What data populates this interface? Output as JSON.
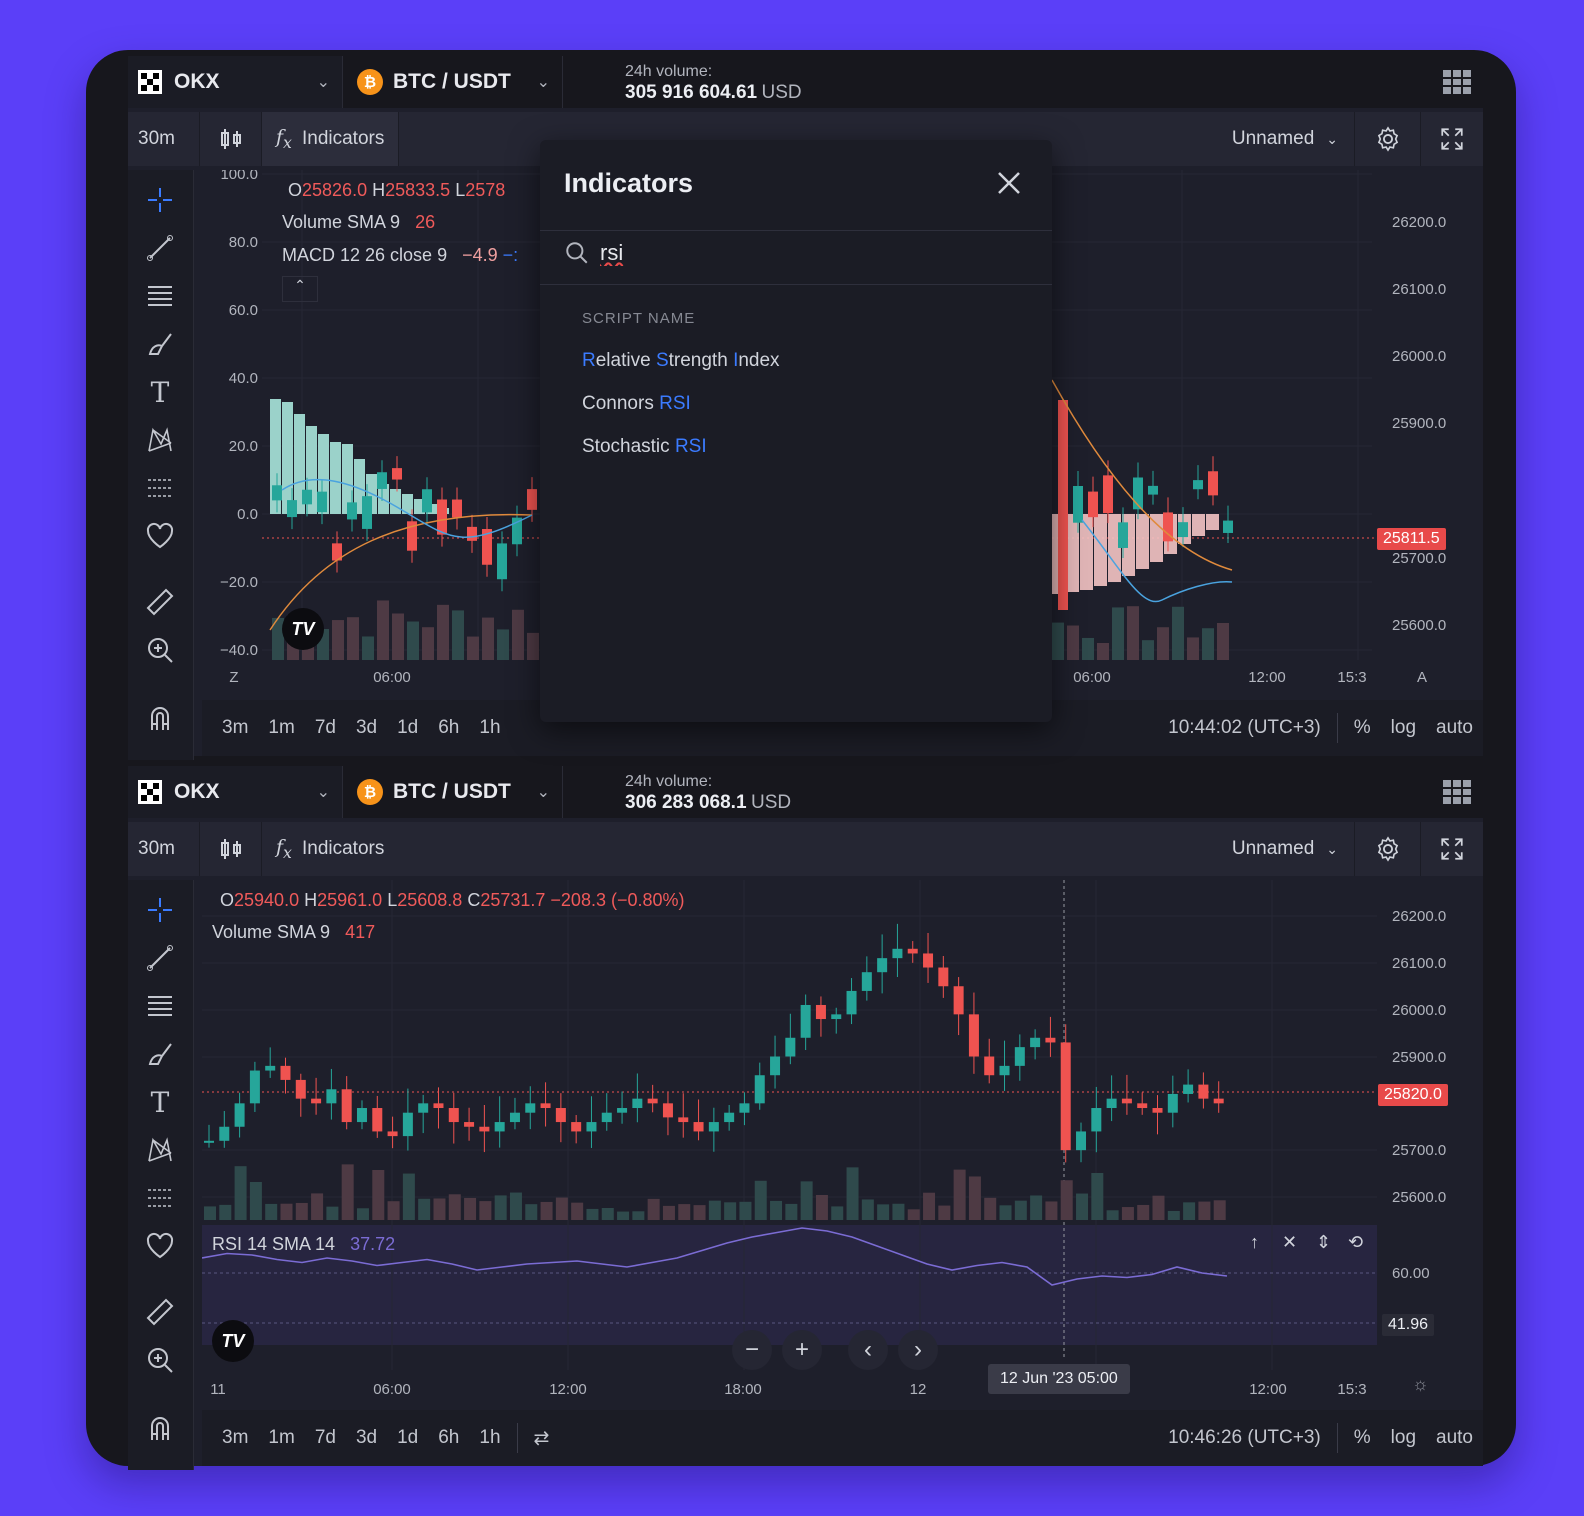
{
  "widgets": [
    {
      "exchange": "OKX",
      "pair": "BTC / USDT",
      "volume_label": "24h volume:",
      "volume_value": "305 916 604.61",
      "volume_currency": "USD",
      "interval": "30m",
      "indicators_label": "Indicators",
      "layout_name": "Unnamed",
      "legend": {
        "o_label": "O",
        "o_value": "25826.0",
        "h_label": "H",
        "h_value": "25833.5",
        "l_label": "L",
        "l_value": "2578",
        "volume_sma": "Volume SMA 9",
        "volume_sma_value": "26",
        "macd": "MACD 12 26 close 9",
        "macd_value": "−4.9",
        "macd_value2": "−:"
      },
      "y_left_ticks": [
        "100.0",
        "80.0",
        "60.0",
        "40.0",
        "20.0",
        "0.0",
        "−20.0",
        "−40.0"
      ],
      "y_right_ticks": [
        "26200.0",
        "26100.0",
        "26000.0",
        "25900.0",
        "25700.0",
        "25600.0"
      ],
      "last_price": "25811.5",
      "x_ticks": [
        "Z",
        "06:00",
        "06:00",
        "12:00",
        "15:3",
        "A"
      ],
      "ranges": [
        "3m",
        "1m",
        "7d",
        "3d",
        "1d",
        "6h",
        "1h"
      ],
      "clock": "10:44:02 (UTC+3)",
      "scale_options": [
        "%",
        "log",
        "auto"
      ]
    },
    {
      "exchange": "OKX",
      "pair": "BTC / USDT",
      "volume_label": "24h volume:",
      "volume_value": "306 283 068.1",
      "volume_currency": "USD",
      "interval": "30m",
      "indicators_label": "Indicators",
      "layout_name": "Unnamed",
      "legend": {
        "o_label": "O",
        "o_value": "25940.0",
        "h_label": "H",
        "h_value": "25961.0",
        "l_label": "L",
        "l_value": "25608.8",
        "c_label": "C",
        "c_value": "25731.7",
        "change": "−208.3 (−0.80%)",
        "volume_sma": "Volume SMA 9",
        "volume_sma_value": "417"
      },
      "rsi_label": "RSI 14 SMA 14",
      "rsi_value": "37.72",
      "rsi_ticks": [
        "60.00"
      ],
      "rsi_last": "41.96",
      "y_right_ticks": [
        "26200.0",
        "26100.0",
        "26000.0",
        "25900.0",
        "25700.0",
        "25600.0"
      ],
      "last_price": "25820.0",
      "x_ticks": [
        "11",
        "06:00",
        "12:00",
        "18:00",
        "12",
        "12:00",
        "15:3"
      ],
      "crosshair_time": "12 Jun '23  05:00",
      "ranges": [
        "3m",
        "1m",
        "7d",
        "3d",
        "1d",
        "6h",
        "1h"
      ],
      "clock": "10:46:26 (UTC+3)",
      "scale_options": [
        "%",
        "log",
        "auto"
      ]
    }
  ],
  "modal": {
    "title": "Indicators",
    "search_value": "rsi",
    "section": "SCRIPT NAME",
    "results": [
      {
        "parts": [
          [
            "R",
            true
          ],
          [
            "elative ",
            false
          ],
          [
            "S",
            true
          ],
          [
            "trength ",
            false
          ],
          [
            "I",
            true
          ],
          [
            "ndex",
            false
          ]
        ]
      },
      {
        "parts": [
          [
            "Connors ",
            false
          ],
          [
            "RSI",
            true
          ]
        ]
      },
      {
        "parts": [
          [
            "Stochastic ",
            false
          ],
          [
            "RSI",
            true
          ]
        ]
      }
    ]
  },
  "colors": {
    "background": "#5b3ff8",
    "up": "#26a69a",
    "down": "#ef5350",
    "highlight": "#3b7bff",
    "rsi": "#7b6cd4"
  },
  "chart_data": [
    {
      "type": "candlestick",
      "title": "",
      "ylim": [
        25560,
        26250
      ],
      "series": [
        {
          "name": "RSI 14",
          "values": [
            58,
            61,
            60,
            57,
            55,
            58,
            56,
            53,
            55,
            57,
            54,
            50,
            52,
            54,
            55,
            56,
            54,
            52,
            55,
            58,
            63,
            68,
            72,
            75,
            78,
            76,
            72,
            66,
            60,
            54,
            50,
            53,
            55,
            52,
            40,
            44,
            46,
            45,
            47,
            52,
            48,
            46
          ]
        }
      ]
    }
  ]
}
